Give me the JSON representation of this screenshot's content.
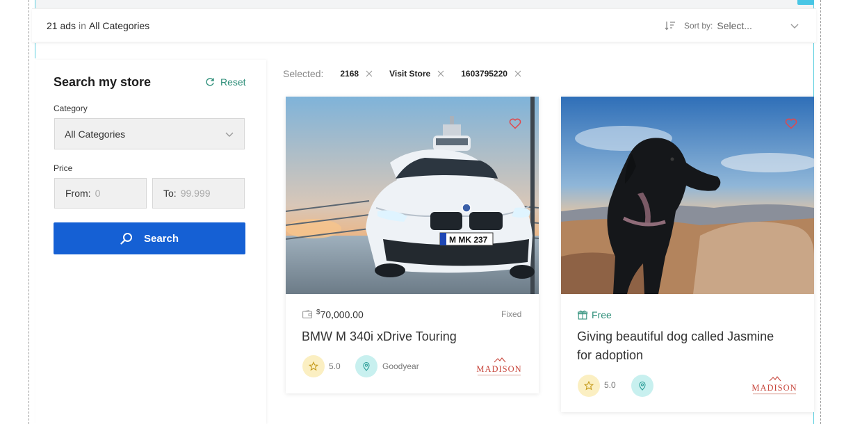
{
  "results": {
    "count": "21 ads",
    "in": "in",
    "category": "All Categories"
  },
  "sort": {
    "label": "Sort by:",
    "value": "Select...",
    "icon": "sort-icon"
  },
  "sidebar": {
    "title": "Search my store",
    "reset": "Reset",
    "category_label": "Category",
    "category_value": "All Categories",
    "price_label": "Price",
    "from_label": "From:",
    "from_placeholder": "0",
    "to_label": "To:",
    "to_placeholder": "99.999",
    "search_button": "Search"
  },
  "filters": {
    "label": "Selected:",
    "chips": [
      "2168",
      "Visit Store",
      "1603795220"
    ]
  },
  "listings": [
    {
      "currency": "$",
      "price": "70,000.00",
      "price_type": "Fixed",
      "title": "BMW M 340i xDrive Touring",
      "rating": "5.0",
      "location": "Goodyear",
      "logo": "MADISON",
      "plate": "M MK 237"
    },
    {
      "price": "Free",
      "title_line1": "Giving beautiful dog called Jasmine",
      "title_line2": "for adoption",
      "rating": "5.0",
      "logo": "MADISON"
    }
  ],
  "colors": {
    "primary": "#1560d4",
    "accent": "#2f8f7a",
    "heart": "#e2474b",
    "rating_bg": "#fbefc2",
    "location_bg": "#c8f0ef"
  }
}
